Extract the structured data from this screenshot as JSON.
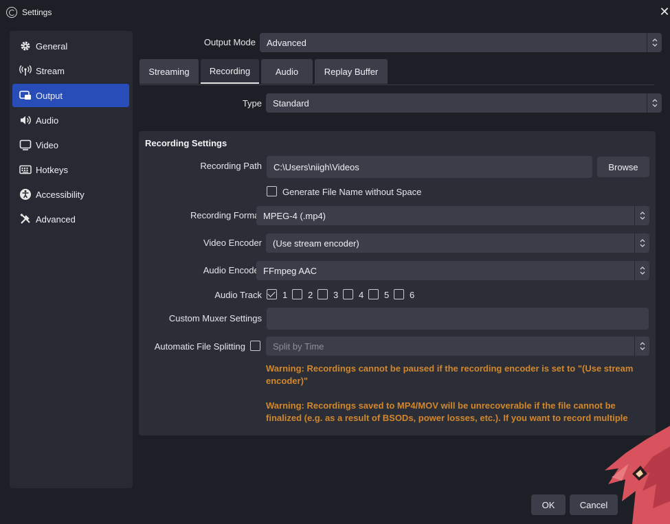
{
  "window": {
    "title": "Settings"
  },
  "sidebar": {
    "items": [
      {
        "label": "General",
        "icon": "gear-icon"
      },
      {
        "label": "Stream",
        "icon": "antenna-icon"
      },
      {
        "label": "Output",
        "icon": "output-icon",
        "active": true
      },
      {
        "label": "Audio",
        "icon": "speaker-icon"
      },
      {
        "label": "Video",
        "icon": "monitor-icon"
      },
      {
        "label": "Hotkeys",
        "icon": "keyboard-icon"
      },
      {
        "label": "Accessibility",
        "icon": "accessibility-icon"
      },
      {
        "label": "Advanced",
        "icon": "tools-icon"
      }
    ]
  },
  "output_mode": {
    "label": "Output Mode",
    "value": "Advanced"
  },
  "tabs": [
    {
      "label": "Streaming"
    },
    {
      "label": "Recording",
      "active": true
    },
    {
      "label": "Audio"
    },
    {
      "label": "Replay Buffer"
    }
  ],
  "type": {
    "label": "Type",
    "value": "Standard"
  },
  "recording": {
    "section_title": "Recording Settings",
    "path_label": "Recording Path",
    "path_value": "C:\\Users\\niigh\\Videos",
    "browse_label": "Browse",
    "gen_filename_label": "Generate File Name without Space",
    "gen_filename_checked": false,
    "format_label": "Recording Format",
    "format_value": "MPEG-4 (.mp4)",
    "video_encoder_label": "Video Encoder",
    "video_encoder_value": "(Use stream encoder)",
    "audio_encoder_label": "Audio Encoder",
    "audio_encoder_value": "FFmpeg AAC",
    "audio_track_label": "Audio Track",
    "tracks": [
      {
        "label": "1",
        "checked": true
      },
      {
        "label": "2",
        "checked": false
      },
      {
        "label": "3",
        "checked": false
      },
      {
        "label": "4",
        "checked": false
      },
      {
        "label": "5",
        "checked": false
      },
      {
        "label": "6",
        "checked": false
      }
    ],
    "muxer_label": "Custom Muxer Settings",
    "muxer_value": "",
    "splitting_label": "Automatic File Splitting",
    "splitting_checked": false,
    "splitting_value": "Split by Time",
    "warning_1": "Warning: Recordings cannot be paused if the recording encoder is set to \"(Use stream encoder)\"",
    "warning_2": "Warning: Recordings saved to MP4/MOV will be unrecoverable if the file cannot be finalized (e.g. as a result of BSODs, power losses, etc.). If you want to record multiple"
  },
  "footer": {
    "ok_label": "OK",
    "cancel_label": "Cancel"
  },
  "colors": {
    "accent": "#284cb8",
    "warning": "#d2872d",
    "background": "#1d1f26",
    "panel": "#272a33",
    "control": "#3b3e48"
  }
}
